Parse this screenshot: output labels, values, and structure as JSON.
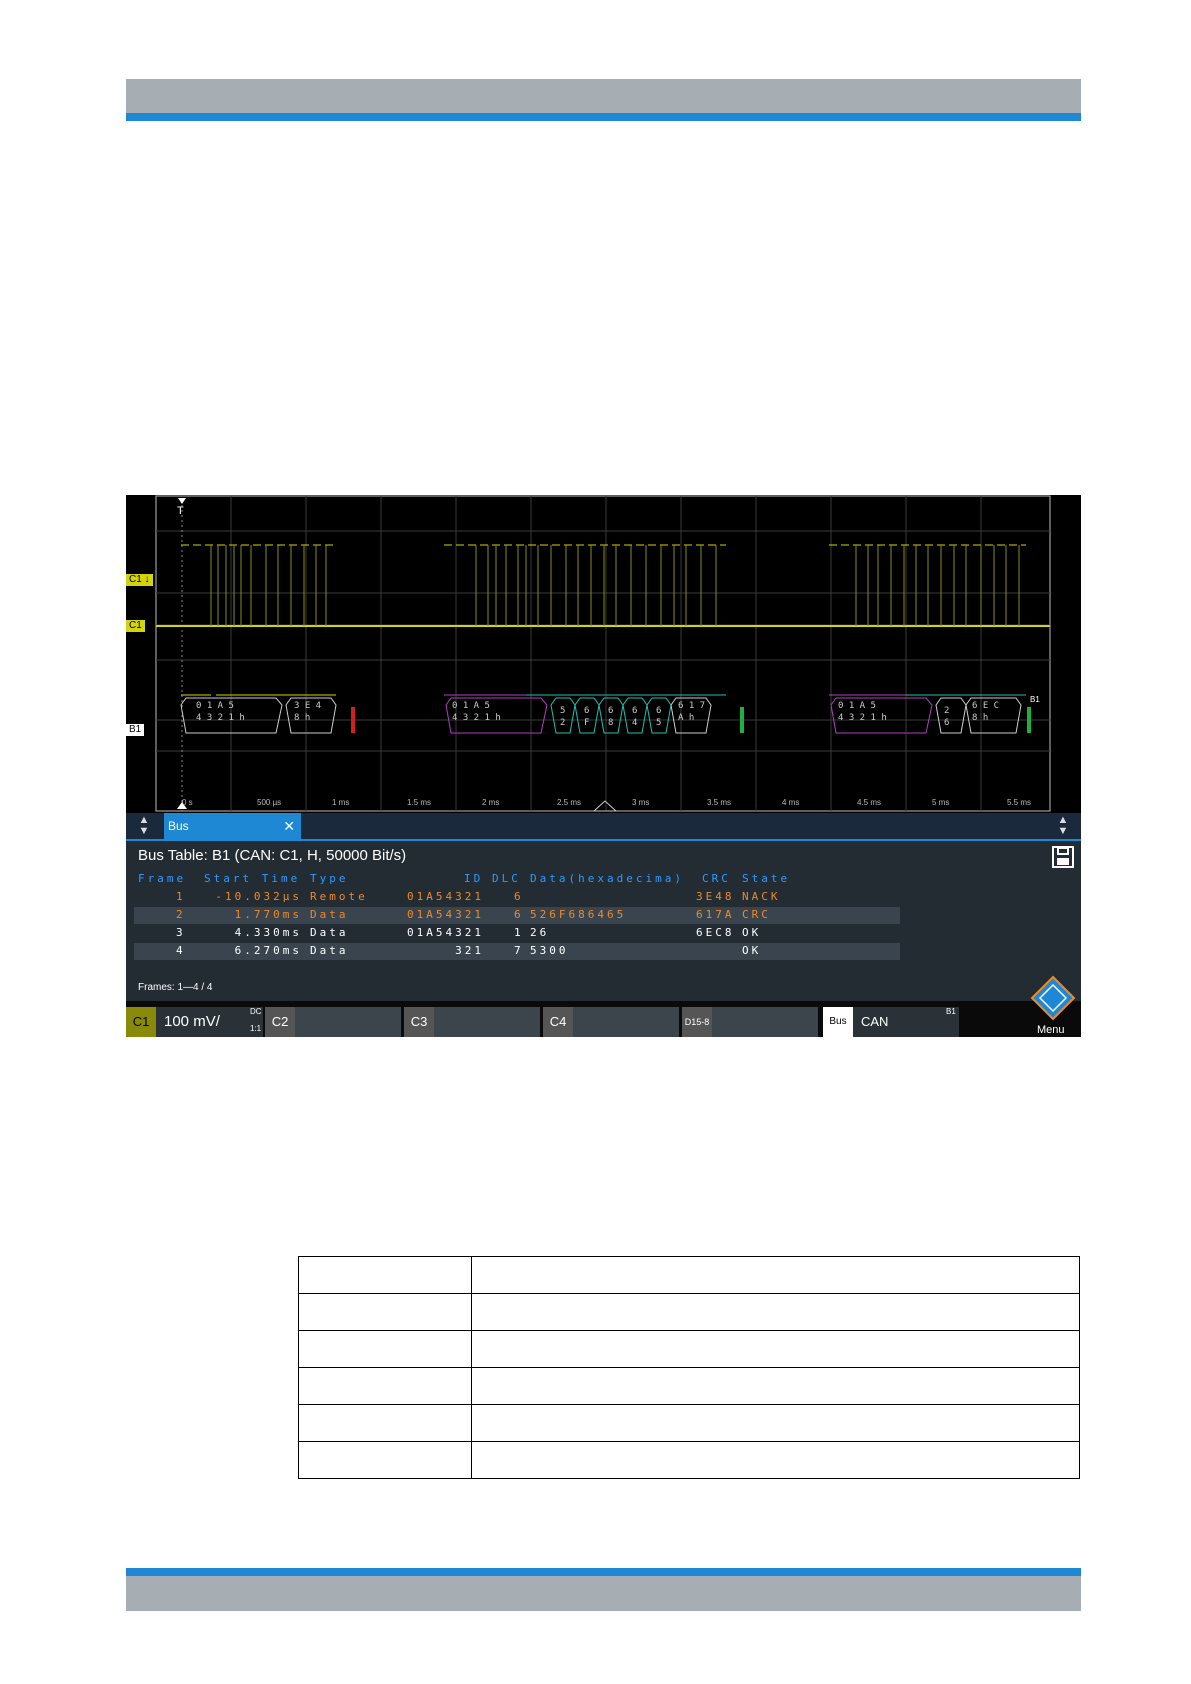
{
  "scope": {
    "labels": {
      "c1_top": "C1 ↓",
      "c1": "C1",
      "b1": "B1",
      "trigger": "T",
      "bus_marker": "B1"
    },
    "time_axis": [
      "0 s",
      "500 µs",
      "1 ms",
      "1.5 ms",
      "2 ms",
      "2.5 ms",
      "3 ms",
      "3.5 ms",
      "4 ms",
      "4.5 ms",
      "5 ms",
      "5.5 ms"
    ],
    "decode_labels": [
      {
        "top": "0 1 A 5",
        "bottom": "4 3 2 1 h"
      },
      {
        "top": "3 E 4",
        "bottom": "8 h"
      },
      {
        "top": "0 1 A 5",
        "bottom": "4 3 2 1 h"
      },
      {
        "top": "5",
        "bottom": "2"
      },
      {
        "top": "6",
        "bottom": "F"
      },
      {
        "top": "6",
        "bottom": "8"
      },
      {
        "top": "6",
        "bottom": "4"
      },
      {
        "top": "6",
        "bottom": "5"
      },
      {
        "top": "6 1 7",
        "bottom": "A h"
      },
      {
        "top": "0 1 A 5",
        "bottom": "4 3 2 1 h"
      },
      {
        "top": "2",
        "bottom": "6"
      },
      {
        "top": "6 E C",
        "bottom": "8 h"
      }
    ]
  },
  "tabbar": {
    "tab_label": "Bus",
    "close": "✕"
  },
  "bus_table": {
    "title": "Bus Table: B1 (CAN: C1, H, 50000 Bit/s)",
    "headers": [
      "Frame",
      "Start Time",
      "Type",
      "ID",
      "DLC",
      "Data(hexadecima)",
      "CRC",
      "State"
    ],
    "rows": [
      {
        "frame": "1",
        "start": "-10.032µs",
        "type": "Remote",
        "id": "01A54321",
        "dlc": "6",
        "data": "",
        "crc": "3E48",
        "state": "NACK",
        "color": "#f08a24"
      },
      {
        "frame": "2",
        "start": "1.770ms",
        "type": "Data",
        "id": "01A54321",
        "dlc": "6",
        "data": "526F686465",
        "crc": "617A",
        "state": "CRC",
        "color": "#f08a24"
      },
      {
        "frame": "3",
        "start": "4.330ms",
        "type": "Data",
        "id": "01A54321",
        "dlc": "1",
        "data": "26",
        "crc": "6EC8",
        "state": "OK",
        "color": "#ffffff"
      },
      {
        "frame": "4",
        "start": "6.270ms",
        "type": "Data",
        "id": "321",
        "dlc": "7",
        "data": "5300",
        "crc": "",
        "state": "OK",
        "color": "#ffffff"
      }
    ],
    "frames_text": "Frames:  1—4 / 4"
  },
  "status_bar": {
    "c1": "C1",
    "c1_scale": "100 mV/",
    "c1_coupling": "DC",
    "c1_ratio": "1:1",
    "c2": "C2",
    "c3": "C3",
    "c4": "C4",
    "digital": "D15-8",
    "bus": "Bus",
    "bus_protocol": "CAN",
    "bus_id": "B1",
    "menu": "Menu"
  },
  "colors": {
    "accent_blue": "#1e88d4",
    "header_gray": "#a6aeb4",
    "c1_yellow": "#d4d40a",
    "orange": "#f08a24"
  },
  "lower_table_rows": [
    [
      "",
      ""
    ],
    [
      "",
      ""
    ],
    [
      "",
      ""
    ],
    [
      "",
      ""
    ],
    [
      "",
      ""
    ],
    [
      "",
      ""
    ]
  ]
}
